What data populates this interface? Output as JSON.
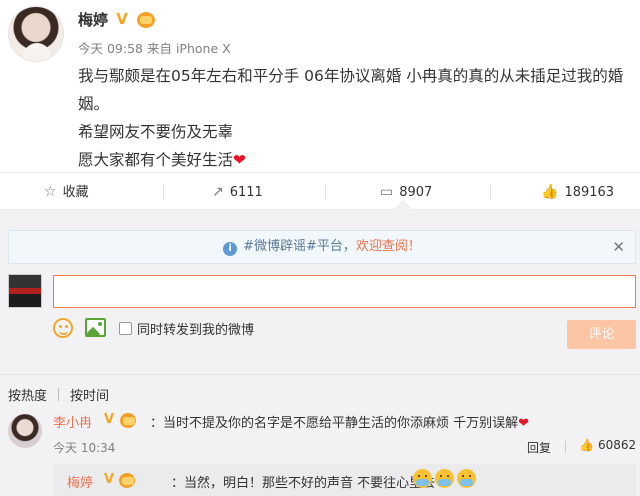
{
  "post": {
    "author": "梅婷",
    "time": "今天 09:58",
    "source": "来自 iPhone X",
    "lines": [
      "我与鄢颇是在05年左右和平分手  06年协议离婚  小冉真的真的从未插足过我的婚姻。",
      "希望网友不要伤及无辜",
      "愿大家都有个美好生活"
    ],
    "heart": "❤"
  },
  "actions": {
    "favorite": {
      "icon": "star-icon",
      "label": "收藏"
    },
    "repost": {
      "icon": "share-icon",
      "count": "6111"
    },
    "comment": {
      "icon": "comment-icon",
      "count": "8907"
    },
    "like": {
      "icon": "thumbs-up-icon",
      "count": "189163"
    }
  },
  "notice": {
    "hashtag": "#微博辟谣#平台，",
    "link": "欢迎查阅！",
    "close": "✕"
  },
  "composer": {
    "input_value": "",
    "placeholder": "",
    "repost_label": "同时转发到我的微博",
    "submit_label": "评论"
  },
  "sort": {
    "hot": "按热度",
    "time": "按时间"
  },
  "comment": {
    "author": "李小冉",
    "text": "：当时不提及你的名字是不愿给平静生活的你添麻烦 千万别误解",
    "heart": "❤",
    "time": "今天 10:34",
    "reply_label": "回复",
    "like_count": "60862"
  },
  "subreply": {
    "author": "梅婷",
    "text": "：当然，明白！那些不好的声音 不要往心里去"
  },
  "colors": {
    "accent": "#eb7350",
    "verified": "#f5a623",
    "link_blue": "#5a7b99"
  }
}
